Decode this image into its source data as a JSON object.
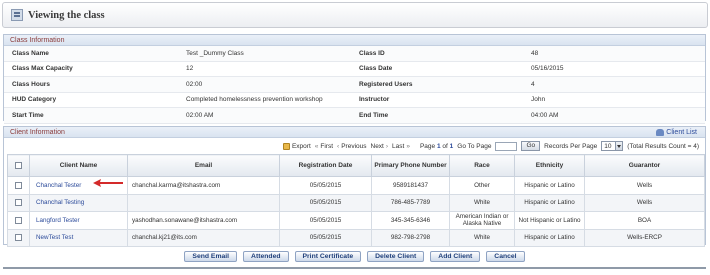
{
  "page": {
    "title": "Viewing the class"
  },
  "class_info": {
    "heading": "Class Information",
    "rows": [
      {
        "l1": "Class Name",
        "v1": "Test _Dummy Class",
        "l2": "Class ID",
        "v2": "48"
      },
      {
        "l1": "Class Max Capacity",
        "v1": "12",
        "l2": "Class Date",
        "v2": "05/16/2015"
      },
      {
        "l1": "Class Hours",
        "v1": "02:00",
        "l2": "Registered Users",
        "v2": "4"
      },
      {
        "l1": "HUD Category",
        "v1": "Completed homelessness prevention workshop",
        "l2": "Instructor",
        "v2": "John"
      },
      {
        "l1": "Start Time",
        "v1": "02:00 AM",
        "l2": "End Time",
        "v2": "04:00 AM"
      }
    ]
  },
  "client_info": {
    "heading": "Client Information",
    "client_list_link": "Client List",
    "toolbar": {
      "export": "Export",
      "first": "First",
      "previous": "Previous",
      "next": "Next",
      "last": "Last",
      "page_label": "Page",
      "page_current": "1",
      "of_label": "of",
      "page_total": "1",
      "go_to_page": "Go To Page",
      "go": "Go",
      "records_per_page": "Records Per Page",
      "records_value": "10",
      "total": "(Total Results Count = 4)"
    },
    "columns": [
      "Client Name",
      "Email",
      "Registration Date",
      "Primary Phone Number",
      "Race",
      "Ethnicity",
      "Guarantor"
    ],
    "rows": [
      {
        "name": "Chanchal Tester",
        "email": "chanchal.karma@itshastra.com",
        "date": "05/05/2015",
        "phone": "9589181437",
        "race": "Other",
        "ethnicity": "Hispanic or Latino",
        "guarantor": "Wells"
      },
      {
        "name": "Chanchal Testing",
        "email": "",
        "date": "05/05/2015",
        "phone": "786-485-7789",
        "race": "White",
        "ethnicity": "Hispanic or Latino",
        "guarantor": "Wells"
      },
      {
        "name": "Langford Tester",
        "email": "yashodhan.sonawane@itshastra.com",
        "date": "05/05/2015",
        "phone": "345-345-6346",
        "race": "American Indian or Alaska Native",
        "ethnicity": "Not Hispanic or Latino",
        "guarantor": "BOA"
      },
      {
        "name": "NewTest Test",
        "email": "chanchal.kj21@its.com",
        "date": "05/05/2015",
        "phone": "982-798-2798",
        "race": "White",
        "ethnicity": "Hispanic or Latino",
        "guarantor": "Wells-ERCP"
      }
    ]
  },
  "actions": {
    "send_email": "Send Email",
    "attended": "Attended",
    "print_certificate": "Print Certificate",
    "delete_client": "Delete Client",
    "add_client": "Add Client",
    "cancel": "Cancel"
  },
  "colors": {
    "header_text": "#8a3b3b",
    "link": "#2b4a9a",
    "arrow": "#d42a2a"
  },
  "icons": [
    "class-icon",
    "client-list-icon",
    "export-icon",
    "first-page-icon",
    "previous-page-icon",
    "next-page-icon",
    "last-page-icon",
    "annotation-arrow-icon"
  ]
}
